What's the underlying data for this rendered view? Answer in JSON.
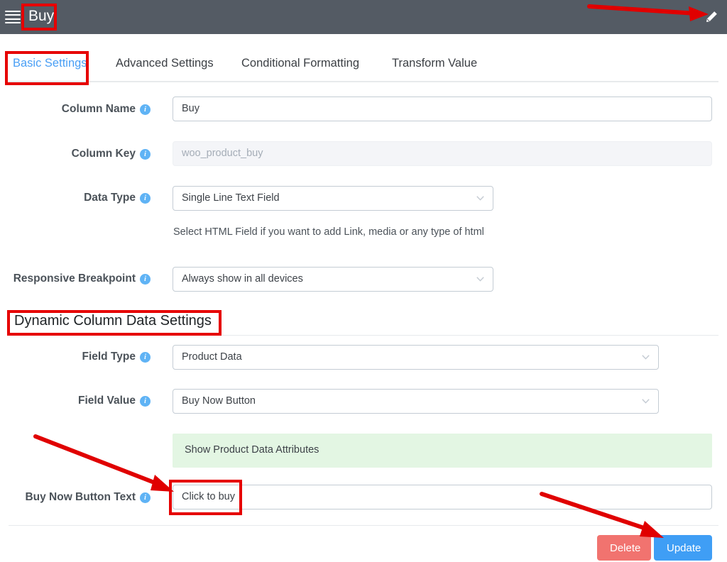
{
  "topbar": {
    "menu_icon": "hamburger-icon",
    "title": "Buy",
    "edit_icon": "pencil-icon"
  },
  "tabs": [
    {
      "label": "Basic Settings",
      "active": true
    },
    {
      "label": "Advanced Settings",
      "active": false
    },
    {
      "label": "Conditional Formatting",
      "active": false
    },
    {
      "label": "Transform Value",
      "active": false
    }
  ],
  "basic_settings": {
    "column_name": {
      "label": "Column Name",
      "value": "Buy",
      "placeholder": "Column Name"
    },
    "column_key": {
      "label": "Column Key",
      "value": "woo_product_buy",
      "placeholder": "woo_product_buy",
      "disabled": true
    },
    "data_type": {
      "label": "Data Type",
      "value": "Single Line Text Field"
    },
    "data_type_helper": "Select HTML Field if you want to add Link, media or any type of html",
    "responsive_breakpoint": {
      "label": "Responsive Breakpoint",
      "value": "Always show in all devices"
    }
  },
  "dynamic_section": {
    "heading": "Dynamic Column Data Settings",
    "field_type": {
      "label": "Field Type",
      "value": "Product Data"
    },
    "field_value": {
      "label": "Field Value",
      "value": "Buy Now Button"
    },
    "notice": "Show Product Data Attributes",
    "buy_now_button_text": {
      "label": "Buy Now Button Text",
      "value": "Click to buy",
      "placeholder": "Click to buy"
    }
  },
  "footer": {
    "delete_label": "Delete",
    "update_label": "Update"
  },
  "colors": {
    "topbar_bg": "#545b64",
    "active_tab": "#4a9ff5",
    "info_icon": "#5fb3f5",
    "notice_bg": "#e3f6e3",
    "delete_button": "#f1736f",
    "update_button": "#3f9ef5",
    "annotation": "#e60000"
  }
}
